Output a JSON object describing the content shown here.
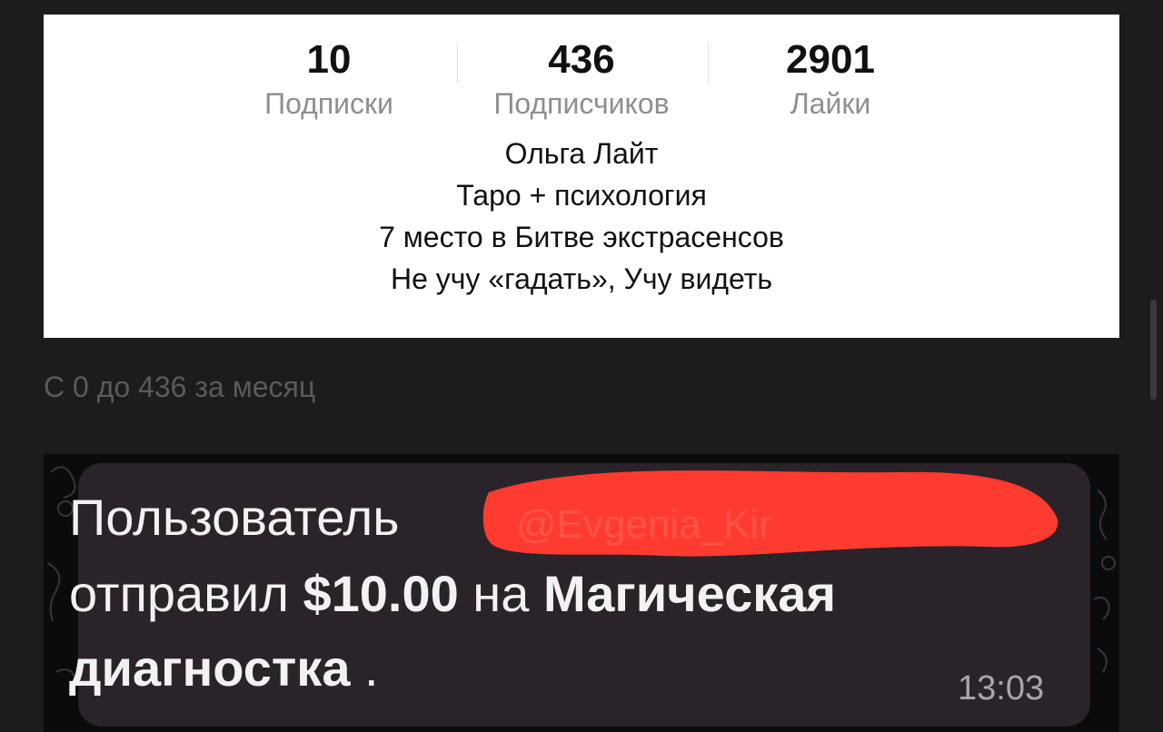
{
  "profile": {
    "stats": [
      {
        "value": "10",
        "label": "Подписки"
      },
      {
        "value": "436",
        "label": "Подписчиков"
      },
      {
        "value": "2901",
        "label": "Лайки"
      }
    ],
    "bio": [
      "Ольга Лайт",
      "Таро + психология",
      "7 место в Битве экстрасенсов",
      "Не учу «гадать», Учу видеть"
    ]
  },
  "caption": "С 0 до 436 за месяц",
  "notification": {
    "line1_prefix": "Пользователь",
    "redacted_username": "@Evgenia_Kir",
    "line2_prefix": "отправил",
    "amount": "$10.00",
    "line2_middle": "на",
    "product_part1": "Магическая",
    "product_part2": "диагностка",
    "line3_suffix": " .",
    "time": "13:03"
  },
  "colors": {
    "page_bg": "#1c1c1e",
    "card_bg": "#ffffff",
    "stat_label": "#8e8e93",
    "caption_text": "#5a5a5f",
    "bubble_bg": "#2a2329",
    "redaction": "#ff3b2f"
  }
}
